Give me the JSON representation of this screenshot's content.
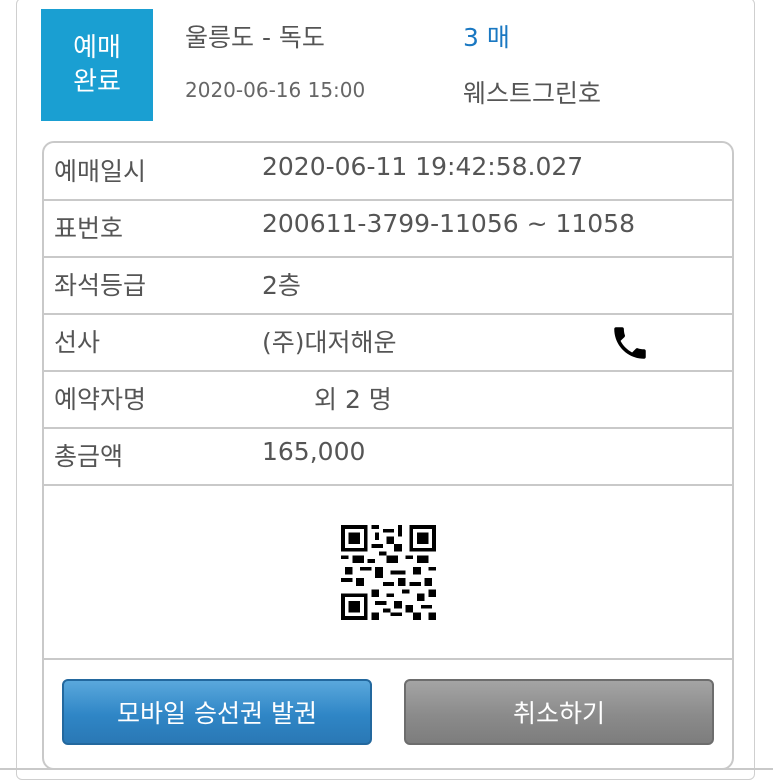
{
  "header": {
    "status_line1": "예매",
    "status_line2": "완료",
    "route": "울릉도 - 독도",
    "ticket_count": "3 매",
    "datetime": "2020-06-16 15:00",
    "ship_name": "웨스트그린호"
  },
  "details": [
    {
      "label": "예매일시",
      "value": "2020-06-11 19:42:58.027"
    },
    {
      "label": "표번호",
      "value": "200611-3799-11056 ~ 11058"
    },
    {
      "label": "좌석등급",
      "value": "2층"
    },
    {
      "label": "선사",
      "value": "(주)대저해운"
    },
    {
      "label": "예약자명",
      "value": "외 2 명"
    },
    {
      "label": "총금액",
      "value": "165,000"
    }
  ],
  "icons": {
    "phone": "phone-icon",
    "qr": "qr-code"
  },
  "buttons": {
    "issue_label": "모바일 승선권 발권",
    "cancel_label": "취소하기"
  },
  "colors": {
    "badge": "#1a9fd2",
    "count": "#1a78c2",
    "issue_button": "#2f86c6",
    "cancel_button": "#8b8b8b"
  }
}
